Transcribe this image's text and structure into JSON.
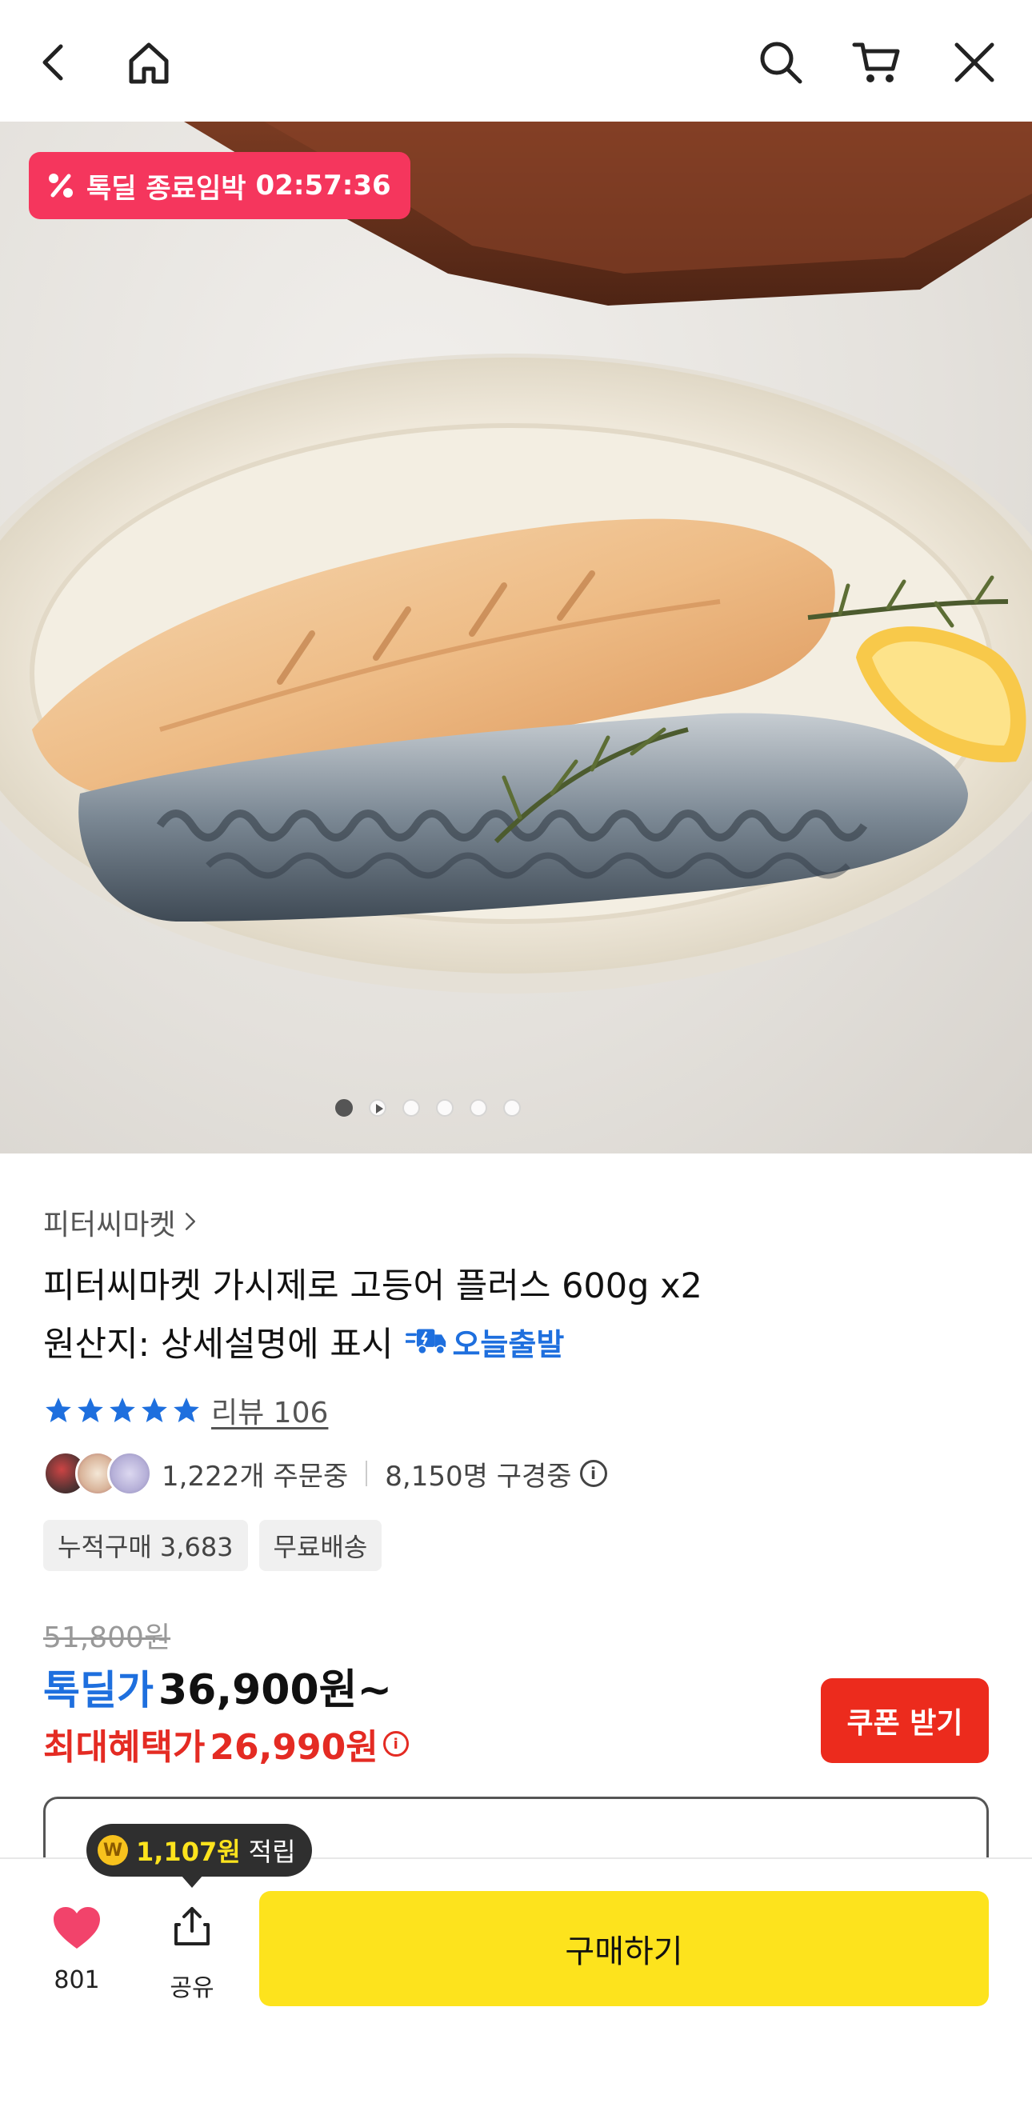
{
  "topbar": {
    "icons": [
      "back-arrow-icon",
      "home-icon",
      "search-icon",
      "cart-icon",
      "close-icon"
    ]
  },
  "hero": {
    "badge_label": "톡딜 종료임박",
    "badge_timer": "02:57:36",
    "carousel": {
      "total": 6,
      "active": 1,
      "video_slide": 2
    }
  },
  "product": {
    "store": "피터씨마켓",
    "title": "피터씨마켓 가시제로 고등어 플러스 600g x2",
    "origin": "원산지: 상세설명에 표시",
    "delivery_tag": "오늘출발",
    "rating_stars": 5,
    "review_link": "리뷰 106",
    "orders_text": "1,222개 주문중",
    "viewers_text": "8,150명 구경중",
    "chips": [
      "누적구매 3,683",
      "무료배송"
    ]
  },
  "price": {
    "original": "51,800원",
    "deal_label": "톡딜가",
    "deal_price": "36,900원~",
    "max_label": "최대혜택가",
    "max_price": "26,990원",
    "coupon_button": "쿠폰 받기"
  },
  "points_tip": {
    "amount": "1,107원",
    "suffix": "적립"
  },
  "bottom": {
    "like_count": "801",
    "share_label": "공유",
    "buy_label": "구매하기"
  },
  "colors": {
    "deal_badge": "#f5365d",
    "deal_blue": "#1e6fde",
    "benefit_red": "#e42b23",
    "coupon_red": "#ec2b1d",
    "buy_yellow": "#fde31d",
    "heart_pink": "#f2436b"
  }
}
